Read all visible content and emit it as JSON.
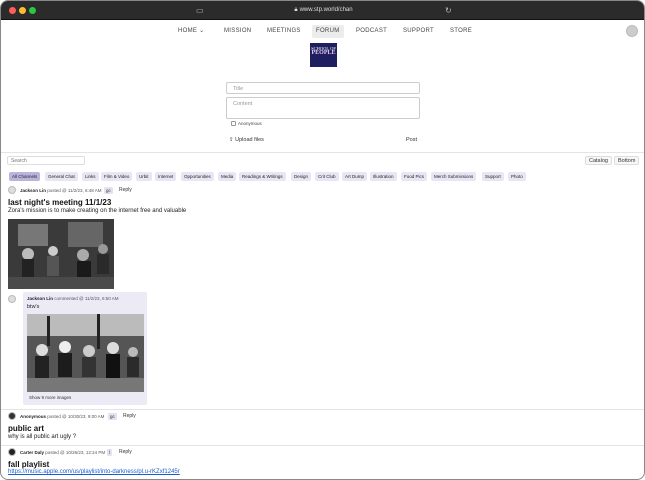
{
  "browser": {
    "url": "www.stp.world/chan"
  },
  "nav": {
    "items": [
      "HOME",
      "MISSION",
      "MEETINGS",
      "FORUM",
      "PODCAST",
      "SUPPORT",
      "STORE"
    ],
    "active": "FORUM"
  },
  "logo": {
    "line1": "SCHOOL OF",
    "line2": "PEOPLE"
  },
  "post_form": {
    "title_placeholder": "Title",
    "content_placeholder": "Content",
    "anonymous_label": "Anonymous",
    "upload_label": "Upload files",
    "post_label": "Post"
  },
  "toolbar": {
    "search_placeholder": "Search",
    "catalog_label": "Catalog",
    "bottom_label": "Bottom"
  },
  "channels": [
    "All Channels",
    "General Chat",
    "Links",
    "Film & Video",
    "Urbit",
    "Internet",
    "Opportunities",
    "Media",
    "Readings & Writings",
    "Design",
    "Crit Club",
    "Art Dump",
    "Illustration",
    "Food Pics",
    "Merch Submissions",
    "Support",
    "Photo"
  ],
  "posts": [
    {
      "author": "Jackson Lin",
      "meta": "posted @ 11/2/23, 6:48 AM",
      "tag": "gc",
      "reply": "Reply",
      "title": "last night's meeting 11/1/23",
      "body": "Zora's mission is to make creating on the internet free and valuable"
    },
    {
      "author": "Anonymous",
      "meta": "posted @ 10/30/23, 9:00 AM",
      "tag": "gc",
      "reply": "Reply",
      "title": "public art",
      "body": "why is all public art ugly ?"
    },
    {
      "author": "Carter Daly",
      "meta": "posted @ 10/26/23, 12:24 PM",
      "tag": "l",
      "reply": "Reply",
      "title": "fall playlist",
      "body": "https://music.apple.com/us/playlist/into-darkness/pl.u-rKZxf1245r"
    }
  ],
  "comment": {
    "author": "Jackson Lin",
    "meta": "commented @ 11/2/23, 6:50 AM",
    "body": "btw's",
    "more": "Show 9 more images"
  },
  "colors": {
    "accent": "#b8b4de",
    "chip": "#e8e6f4",
    "link": "#1a5fd0"
  }
}
